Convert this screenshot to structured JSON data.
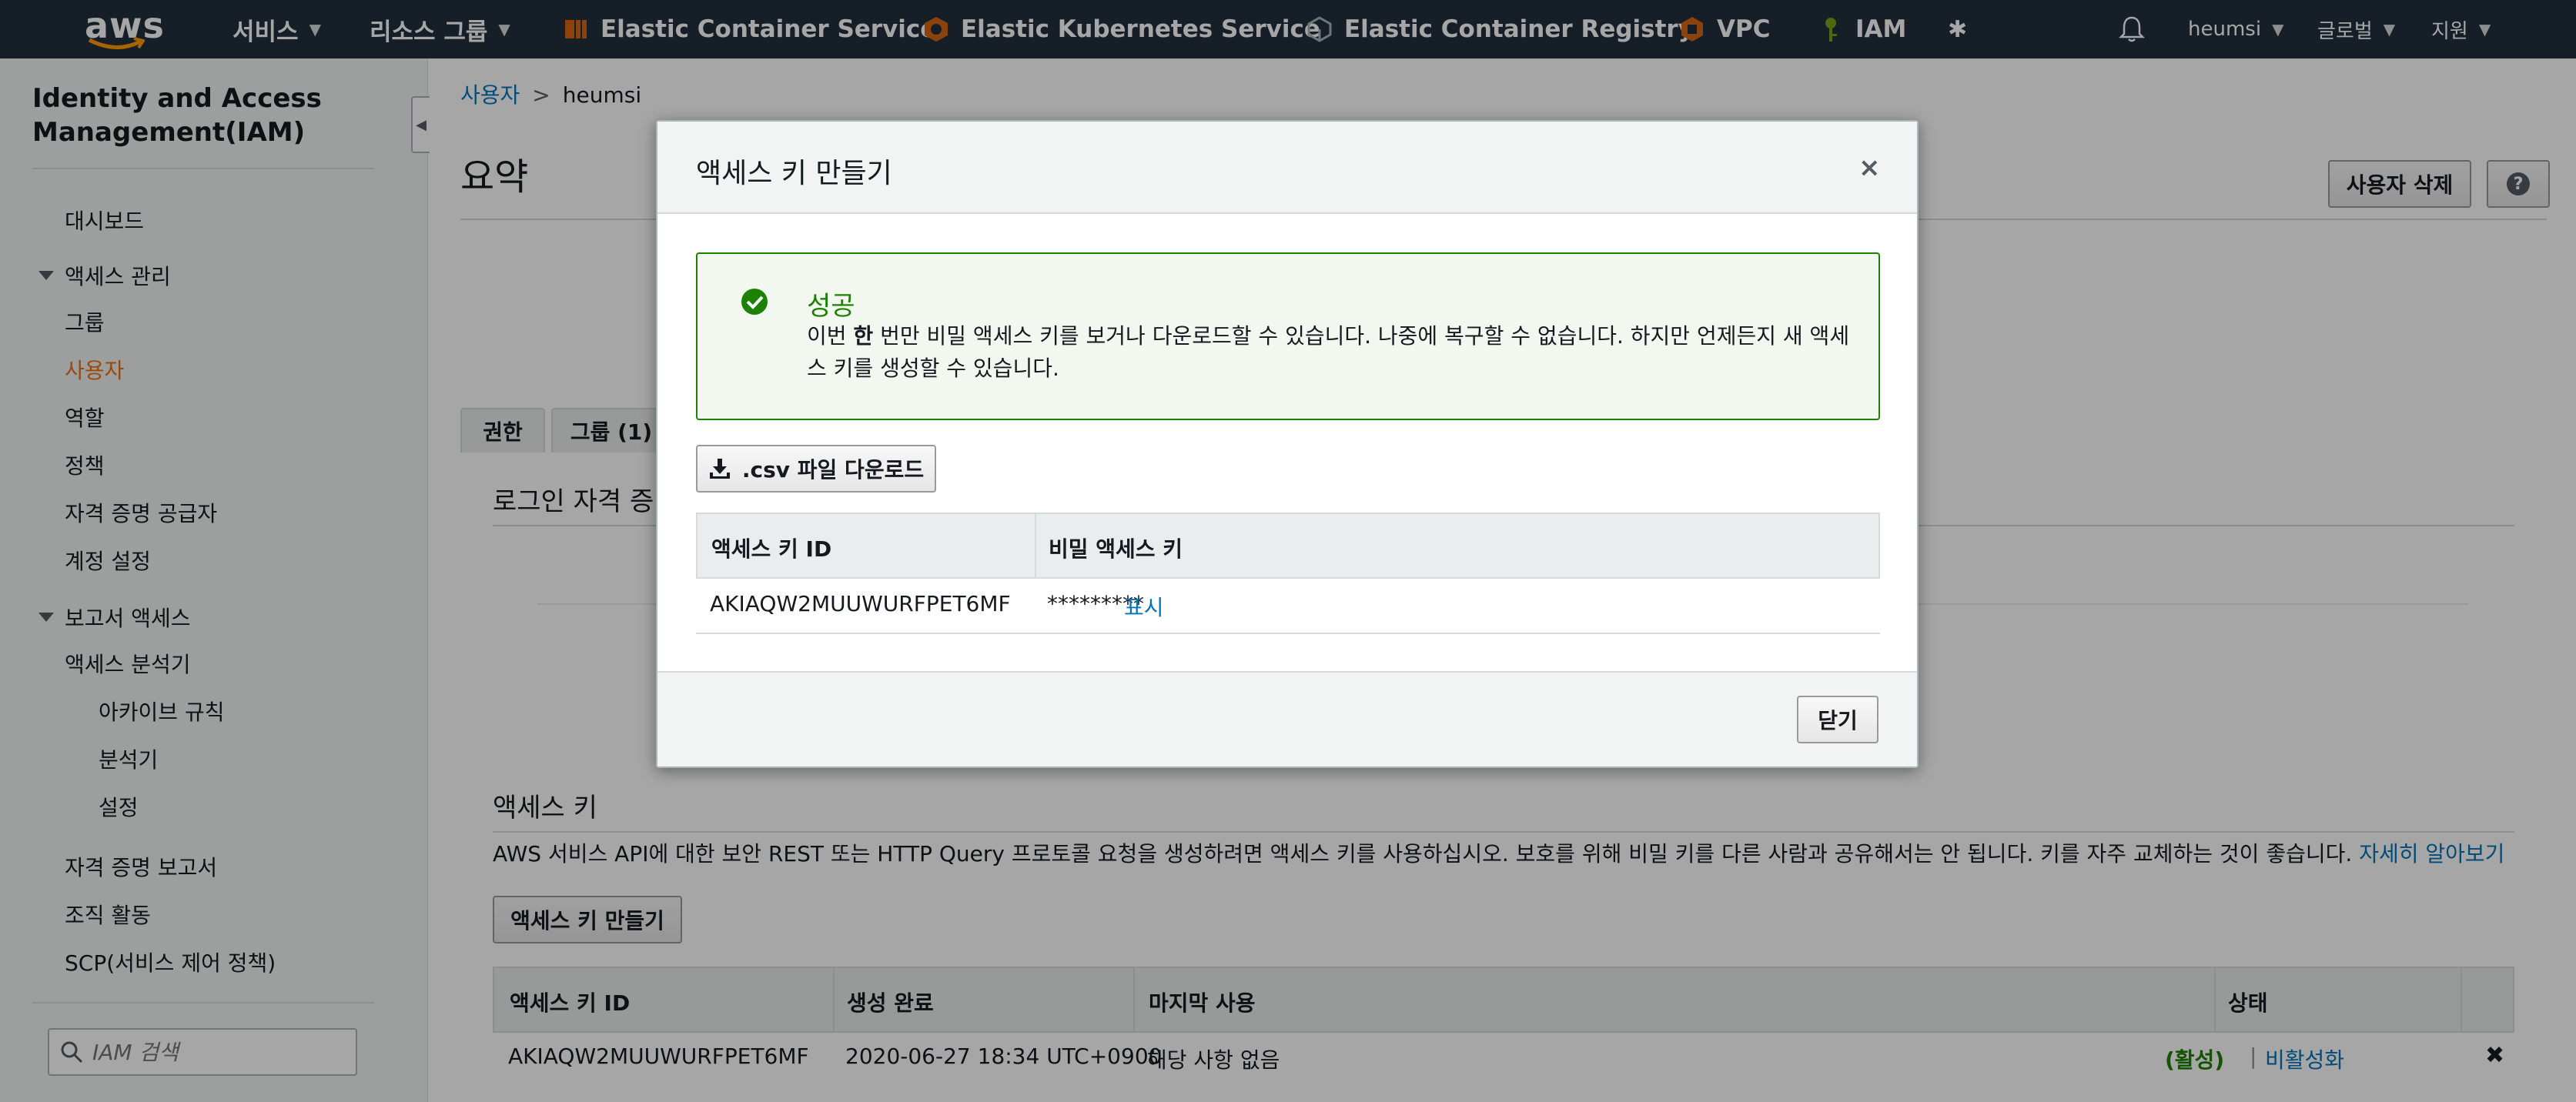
{
  "topnav": {
    "logo_text": "aws",
    "services": "서비스",
    "resource_groups": "리소스 그룹",
    "shortcuts": [
      {
        "label": "Elastic Container Service",
        "icon": "ecs-icon",
        "color": "#d86613"
      },
      {
        "label": "Elastic Kubernetes Service",
        "icon": "eks-icon",
        "color": "#d86613"
      },
      {
        "label": "Elastic Container Registry",
        "icon": "ecr-icon",
        "color": "#aab7b8"
      },
      {
        "label": "VPC",
        "icon": "vpc-icon",
        "color": "#d86613"
      },
      {
        "label": "IAM",
        "icon": "iam-icon",
        "color": "#7aa116"
      }
    ],
    "user": "heumsi",
    "region": "글로벌",
    "support": "지원"
  },
  "sidebar": {
    "title": "Identity and Access Management(IAM)",
    "dashboard": "대시보드",
    "access_mgmt": "액세스 관리",
    "items_access": [
      "그룹",
      "사용자",
      "역할",
      "정책",
      "자격 증명 공급자",
      "계정 설정"
    ],
    "active_item": "사용자",
    "report_access": "보고서 액세스",
    "analyzer": "액세스 분석기",
    "analyzer_sub": [
      "아카이브 규칙",
      "분석기",
      "설정"
    ],
    "items_bottom": [
      "자격 증명 보고서",
      "조직 활동",
      "SCP(서비스 제어 정책)"
    ],
    "search_placeholder": "IAM 검색"
  },
  "main": {
    "breadcrumb_parent": "사용자",
    "breadcrumb_current": "heumsi",
    "title": "요약",
    "delete_user": "사용자 삭제",
    "help": "?",
    "tabs": [
      "권한",
      "그룹 (1)"
    ],
    "signin_section": "로그인 자격 증명",
    "access_keys_title": "액세스 키",
    "access_keys_desc": "AWS 서비스 API에 대한 보안 REST 또는 HTTP Query 프로토콜 요청을 생성하려면 액세스 키를 사용하십시오. 보호를 위해 비밀 키를 다른 사람과 공유해서는 안 됩니다. 키를 자주 교체하는 것이 좋습니다.",
    "learn_more": "자세히 알아보기",
    "create_key_btn": "액세스 키 만들기",
    "table_headers": [
      "액세스 키 ID",
      "생성 완료",
      "마지막 사용",
      "상태"
    ],
    "rows": [
      {
        "key_id": "AKIAQW2MUUWURFPET6MF",
        "created": "2020-06-27 18:34 UTC+0900",
        "last_used": "해당 사항 없음",
        "status": "(활성)",
        "action": "비활성화"
      }
    ]
  },
  "modal": {
    "title": "액세스 키 만들기",
    "close_x": "×",
    "alert_title": "성공",
    "alert_msg_pre": "이번 ",
    "alert_msg_bold": "한",
    "alert_msg_post": " 번만 비밀 액세스 키를 보거나 다운로드할 수 있습니다. 나중에 복구할 수 없습니다. 하지만 언제든지 새 액세스 키를 생성할 수 있습니다.",
    "csv_btn": ".csv 파일 다운로드",
    "headers": [
      "액세스 키 ID",
      "비밀 액세스 키"
    ],
    "key_id": "AKIAQW2MUUWURFPET6MF",
    "secret_masked": "*********",
    "show_link": "표시",
    "close_btn": "닫기"
  }
}
